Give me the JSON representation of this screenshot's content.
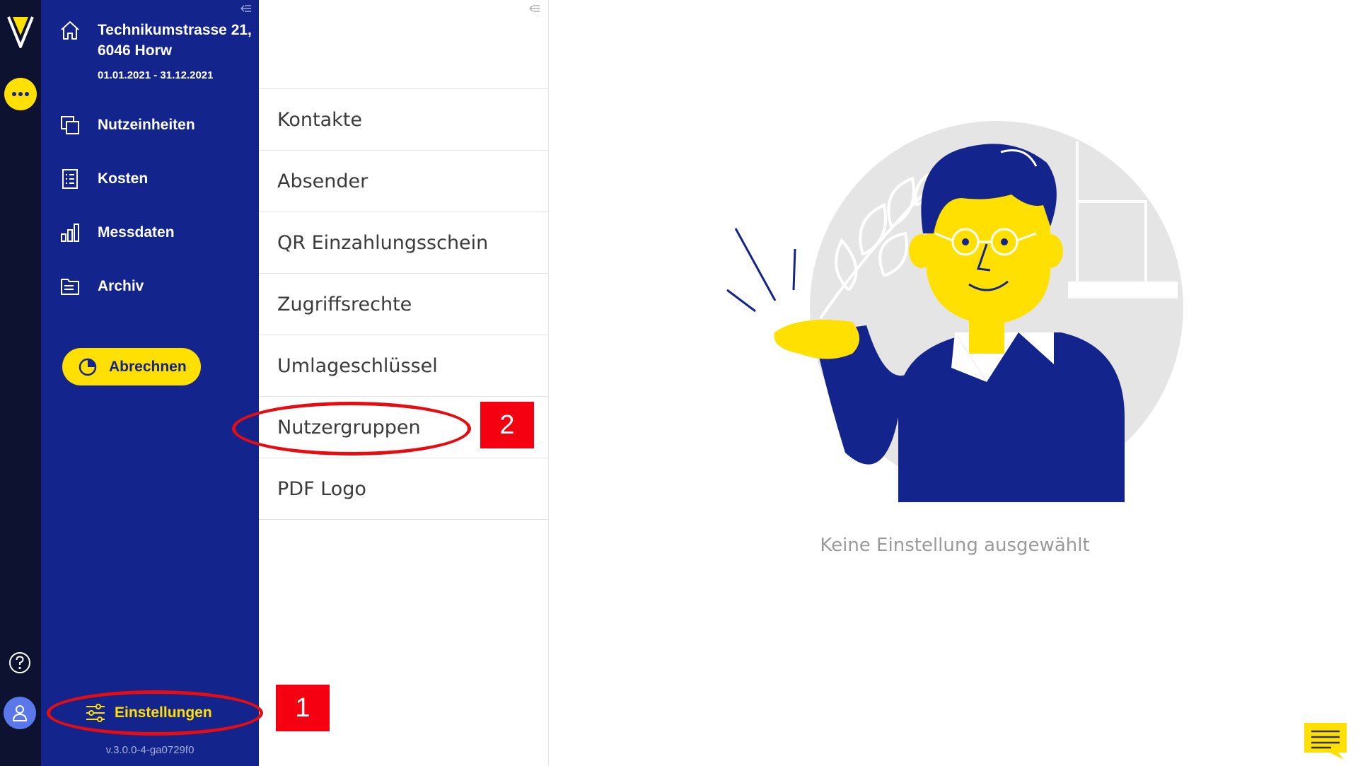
{
  "colors": {
    "rail": "#0c1230",
    "nav": "#13248c",
    "accent": "#ffe000",
    "annotation": "#f50010"
  },
  "icons": {
    "logo": "v-logo-icon",
    "more": "more-dots-icon",
    "help": "help-icon",
    "user": "user-icon",
    "home": "home-icon",
    "units": "copy-icon",
    "costs": "receipt-icon",
    "measure": "bar-chart-icon",
    "archive": "folder-icon",
    "settle": "pie-chart-icon",
    "settings": "sliders-icon",
    "collapse": "collapse-icon",
    "chat": "chat-icon"
  },
  "property": {
    "address": "Technikumstrasse 21, 6046 Horw",
    "period": "01.01.2021 - 31.12.2021"
  },
  "nav": {
    "items": [
      "Nutzeinheiten",
      "Kosten",
      "Messdaten",
      "Archiv"
    ]
  },
  "actions": {
    "settle": "Abrechnen"
  },
  "footer": {
    "settings": "Einstellungen",
    "version": "v.3.0.0-4-ga0729f0"
  },
  "settings_list": [
    "Kontakte",
    "Absender",
    "QR Einzahlungsschein",
    "Zugriffsrechte",
    "Umlageschlüssel",
    "Nutzergruppen",
    "PDF Logo"
  ],
  "main": {
    "empty_state": "Keine Einstellung ausgewählt"
  },
  "annotations": {
    "step1": "1",
    "step2": "2"
  }
}
